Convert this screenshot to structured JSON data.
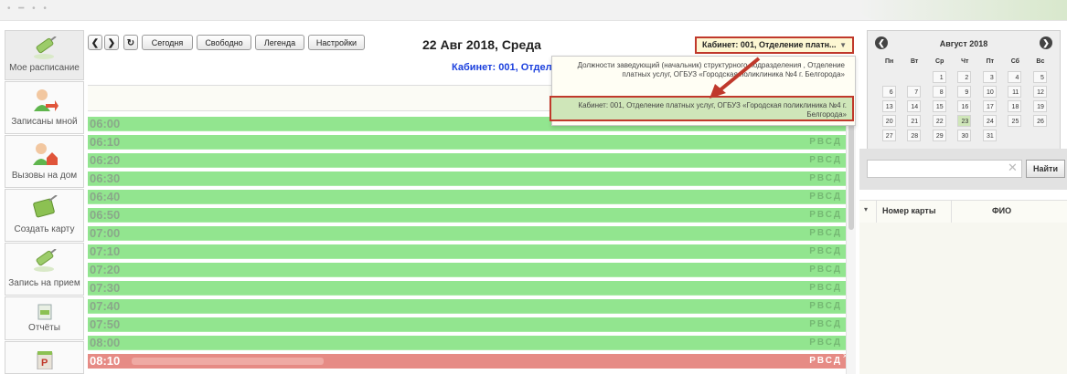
{
  "nav": [
    {
      "label": "Мое расписание",
      "icon": "syringe-icon"
    },
    {
      "label": "Записаны мной",
      "icon": "person-arrow-icon"
    },
    {
      "label": "Вызовы на дом",
      "icon": "person-house-icon"
    },
    {
      "label": "Создать карту",
      "icon": "book-syringe-icon"
    },
    {
      "label": "Запись на прием",
      "icon": "syringe-icon"
    },
    {
      "label": "Отчёты",
      "icon": "report-icon"
    },
    {
      "label": "",
      "icon": "calendar-p-icon"
    }
  ],
  "toolbar": {
    "prev": "❮",
    "next": "❯",
    "refresh": "↻",
    "today": "Сегодня",
    "free": "Свободно",
    "legend": "Легенда",
    "settings": "Настройки"
  },
  "schedule": {
    "date": "22 Авг 2018, Среда",
    "room_select": "Кабинет: 001, Отделение платн...",
    "subtitle": "Кабинет: 001, Отделение г",
    "slots": [
      {
        "time": "06:00",
        "flags": ""
      },
      {
        "time": "06:10",
        "flags": "РВСД"
      },
      {
        "time": "06:20",
        "flags": "РВСД"
      },
      {
        "time": "06:30",
        "flags": "РВСД"
      },
      {
        "time": "06:40",
        "flags": "РВСД"
      },
      {
        "time": "06:50",
        "flags": "РВСД"
      },
      {
        "time": "07:00",
        "flags": "РВСД"
      },
      {
        "time": "07:10",
        "flags": "РВСД"
      },
      {
        "time": "07:20",
        "flags": "РВСД"
      },
      {
        "time": "07:30",
        "flags": "РВСД"
      },
      {
        "time": "07:40",
        "flags": "РВСД"
      },
      {
        "time": "07:50",
        "flags": "РВСД"
      },
      {
        "time": "08:00",
        "flags": "РВСД"
      },
      {
        "time": "08:10",
        "flags": "РВСД",
        "booked": true
      }
    ]
  },
  "dropdown": {
    "options": [
      "Должности заведующий (начальник) структурного подразделения , Отделение платных услуг, ОГБУЗ «Городская поликлиника №4 г. Белгорода»",
      "Кабинет: 001, Отделение платных услуг, ОГБУЗ «Городская поликлиника №4 г. Белгорода»"
    ],
    "selected_index": 1
  },
  "calendar": {
    "month": "Август 2018",
    "weekdays": [
      "Пн",
      "Вт",
      "Ср",
      "Чт",
      "Пт",
      "Сб",
      "Вс"
    ],
    "weeks": [
      [
        "",
        "",
        "1",
        "2",
        "3",
        "4",
        "5"
      ],
      [
        "6",
        "7",
        "8",
        "9",
        "10",
        "11",
        "12"
      ],
      [
        "13",
        "14",
        "15",
        "16",
        "17",
        "18",
        "19"
      ],
      [
        "20",
        "21",
        "22",
        "23",
        "24",
        "25",
        "26"
      ],
      [
        "27",
        "28",
        "29",
        "30",
        "31",
        "",
        ""
      ]
    ],
    "today": "23"
  },
  "search": {
    "placeholder": "",
    "button": "Найти",
    "clear": "✕"
  },
  "table": {
    "toggle": "▾",
    "columns": [
      "Номер карты",
      "ФИО"
    ]
  }
}
